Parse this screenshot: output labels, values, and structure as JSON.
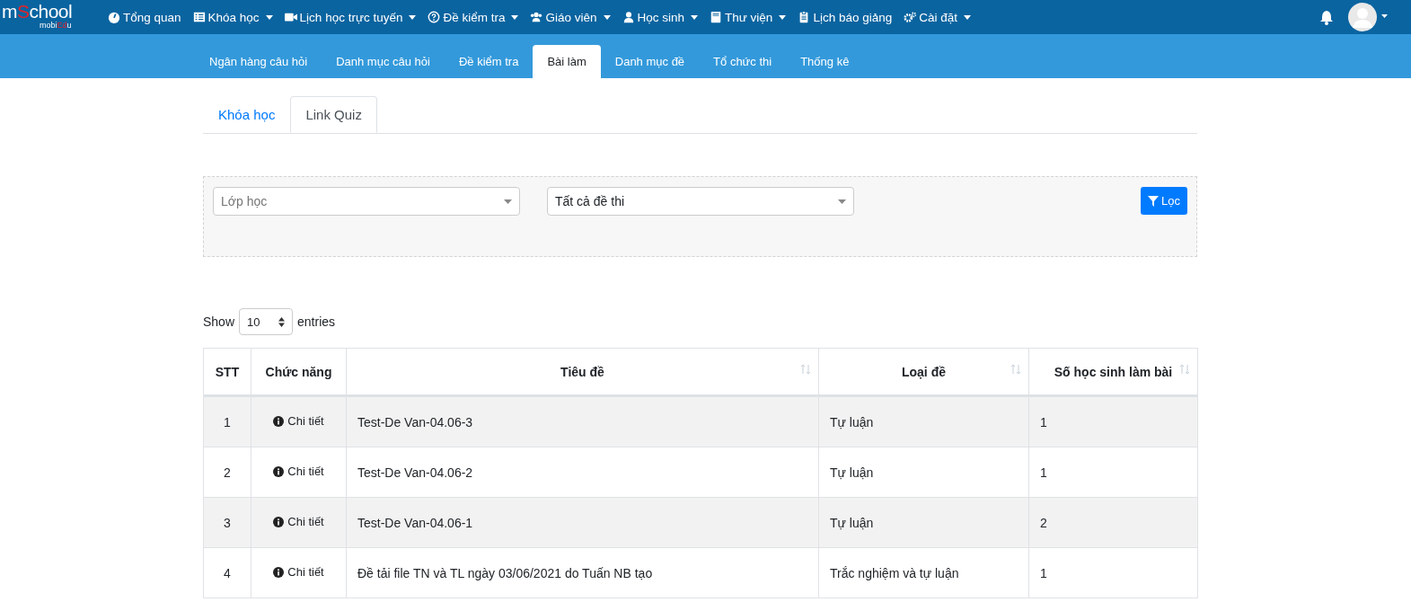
{
  "logo": {
    "parts": [
      {
        "text": "m",
        "accent": false
      },
      {
        "text": "S",
        "accent": true
      },
      {
        "text": "chool",
        "accent": false
      }
    ],
    "sub_parts": [
      {
        "text": "mobi",
        "accent": false
      },
      {
        "text": "Ed",
        "accent": true
      },
      {
        "text": "u",
        "accent": false
      }
    ]
  },
  "nav": [
    {
      "label": "Tổng quan",
      "dropdown": false
    },
    {
      "label": "Khóa học",
      "dropdown": true
    },
    {
      "label": "Lịch học trực tuyến",
      "dropdown": true
    },
    {
      "label": "Đề kiểm tra",
      "dropdown": true
    },
    {
      "label": "Giáo viên",
      "dropdown": true
    },
    {
      "label": "Học sinh",
      "dropdown": true
    },
    {
      "label": "Thư viện",
      "dropdown": true
    },
    {
      "label": "Lịch báo giảng",
      "dropdown": false
    },
    {
      "label": "Cài đặt",
      "dropdown": true
    }
  ],
  "subnav": [
    {
      "label": "Ngân hàng câu hỏi",
      "selected": false
    },
    {
      "label": "Danh mục câu hỏi",
      "selected": false
    },
    {
      "label": "Đề kiểm tra",
      "selected": false
    },
    {
      "label": "Bài làm",
      "selected": true
    },
    {
      "label": "Danh mục đề",
      "selected": false
    },
    {
      "label": "Tổ chức thi",
      "selected": false
    },
    {
      "label": "Thống kê",
      "selected": false
    }
  ],
  "tabs": [
    {
      "label": "Khóa học",
      "selected": false
    },
    {
      "label": "Link Quiz",
      "selected": true
    }
  ],
  "filter": {
    "class_select": {
      "placeholder": "Lớp học"
    },
    "exam_select": {
      "value": "Tất cả đề thi"
    },
    "button": "Lọc"
  },
  "length": {
    "show": "Show",
    "value": "10",
    "entries": "entries"
  },
  "table": {
    "columns": [
      {
        "label": "STT",
        "sortable": false
      },
      {
        "label": "Chức năng",
        "sortable": false
      },
      {
        "label": "Tiêu đề",
        "sortable": true
      },
      {
        "label": "Loại đề",
        "sortable": true
      },
      {
        "label": "Số học sinh làm bài",
        "sortable": true
      }
    ],
    "rows": [
      {
        "stt": "1",
        "action": "Chi tiết",
        "title": "Test-De Van-04.06-3",
        "type": "Tự luận",
        "count": "1"
      },
      {
        "stt": "2",
        "action": "Chi tiết",
        "title": "Test-De Van-04.06-2",
        "type": "Tự luận",
        "count": "1"
      },
      {
        "stt": "3",
        "action": "Chi tiết",
        "title": "Test-De Van-04.06-1",
        "type": "Tự luận",
        "count": "2"
      },
      {
        "stt": "4",
        "action": "Chi tiết",
        "title": "Đề tải file TN và TL ngày 03/06/2021 do Tuấn NB tạo",
        "type": "Trắc nghiệm và tự luận",
        "count": "1"
      }
    ]
  }
}
